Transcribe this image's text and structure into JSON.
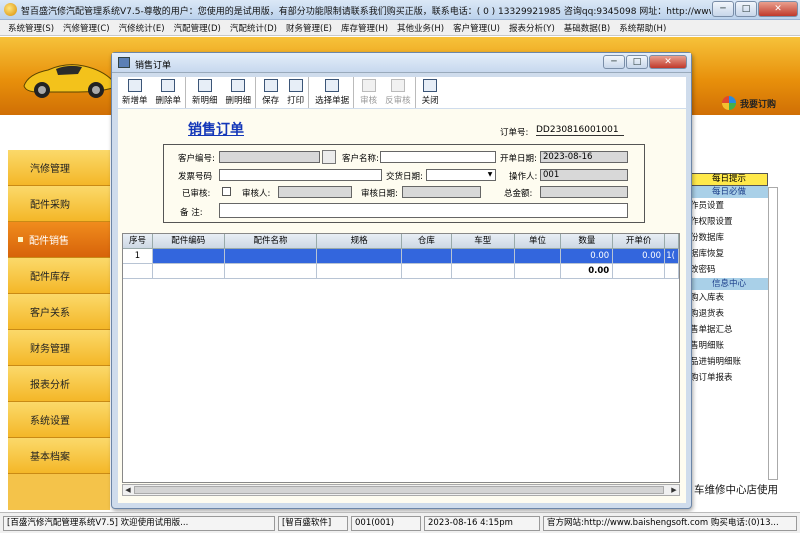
{
  "app": {
    "title": "智百盛汽修汽配管理系统V7.5-尊敬的用户：您使用的是试用版，有部分功能限制请联系我们购买正版，联系电话：( 0 ) 13329921985  咨询qq:9345098   网址：http://www.bai..."
  },
  "window_buttons": {
    "minimize": "─",
    "maximize": "□",
    "close": "✕"
  },
  "menu": [
    "系统管理(S)",
    "汽修管理(C)",
    "汽修统计(E)",
    "汽配管理(D)",
    "汽配统计(D)",
    "财务管理(E)",
    "库存管理(H)",
    "其他业务(H)",
    "客户管理(U)",
    "报表分析(Y)",
    "基础数据(B)",
    "系统帮助(H)"
  ],
  "banner": {
    "order_label": "我要订购"
  },
  "sidebar": {
    "items": [
      {
        "label": "汽修管理",
        "active": false
      },
      {
        "label": "配件采购",
        "active": false
      },
      {
        "label": "配件销售",
        "active": true
      },
      {
        "label": "配件库存",
        "active": false
      },
      {
        "label": "客户关系",
        "active": false
      },
      {
        "label": "财务管理",
        "active": false
      },
      {
        "label": "报表分析",
        "active": false
      },
      {
        "label": "系统设置",
        "active": false
      },
      {
        "label": "基本档案",
        "active": false
      }
    ]
  },
  "right_panel": {
    "header": "每日提示",
    "section1": "每日必做",
    "items1": [
      "作员设置",
      "作权限设置",
      "份数据库",
      "据库恢复",
      "改密码"
    ],
    "section2": "信息中心",
    "items2": [
      "购入库表",
      "购退货表",
      "售单据汇总",
      "售明细账",
      "品进销明细账",
      "购订单报表"
    ],
    "footer": "车维修中心店使用"
  },
  "child": {
    "title": "销售订单",
    "toolbar": [
      {
        "label": "新增单",
        "icon": "new-doc-icon",
        "enabled": true
      },
      {
        "label": "删除单",
        "icon": "delete-doc-icon",
        "enabled": true
      },
      {
        "label": "新明细",
        "icon": "new-detail-icon",
        "enabled": true
      },
      {
        "label": "删明细",
        "icon": "delete-detail-icon",
        "enabled": true
      },
      {
        "label": "保存",
        "icon": "save-icon",
        "enabled": true
      },
      {
        "label": "打印",
        "icon": "print-icon",
        "enabled": true
      },
      {
        "label": "选择单据",
        "icon": "binoculars-icon",
        "enabled": true
      },
      {
        "label": "审核",
        "icon": "approve-icon",
        "enabled": false
      },
      {
        "label": "反审核",
        "icon": "unapprove-icon",
        "enabled": false
      },
      {
        "label": "关闭",
        "icon": "exit-icon",
        "enabled": true
      }
    ],
    "doc_title": "销售订单",
    "order_no_label": "订单号:",
    "order_no": "DD230816001001",
    "form": {
      "customer_code_label": "客户编号:",
      "customer_code": "",
      "customer_name_label": "客户名称:",
      "customer_name": "",
      "open_date_label": "开单日期:",
      "open_date": "2023-08-16",
      "invoice_no_label": "发票号码",
      "invoice_no": "",
      "delivery_date_label": "交货日期:",
      "delivery_date": "",
      "operator_label": "操作人:",
      "operator": "001",
      "approved_label": "已审核:",
      "approver_label": "审核人:",
      "approver": "",
      "approve_date_label": "审核日期:",
      "approve_date": "",
      "total_label": "总金额:",
      "total": "",
      "remark_label": "备   注:",
      "remark": ""
    },
    "grid": {
      "columns": [
        "序号",
        "配件编码",
        "配件名称",
        "规格",
        "仓库",
        "车型",
        "单位",
        "数量",
        "开单价",
        ""
      ],
      "rows": [
        [
          "1",
          "",
          "",
          "",
          "",
          "",
          "",
          "0.00",
          "0.00",
          "1("
        ]
      ],
      "totals": [
        "",
        "",
        "",
        "",
        "",
        "",
        "",
        "0.00",
        "",
        ""
      ]
    }
  },
  "statusbar": {
    "app": "[百盛汽修汽配管理系统V7.5] 欢迎使用试用版...",
    "company": "[智百盛软件]",
    "user": "001(001)",
    "datetime": "2023-08-16 4:15pm",
    "website": "官方网站:http://www.baishengsoft.com  购买电话:(0)13..."
  },
  "colors": {
    "banner": "#e8900b",
    "sidebar": "#f4b728",
    "sidebar_active": "#e0700f",
    "doc_title": "#1336b8",
    "grid_selection": "#3366dd"
  }
}
